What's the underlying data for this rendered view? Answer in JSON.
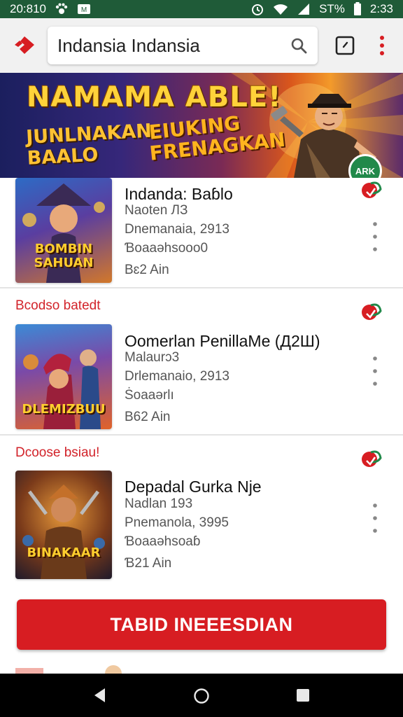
{
  "status_bar": {
    "time_left": "20:810",
    "battery_text": "ST%",
    "time_right": "2:33"
  },
  "toolbar": {
    "search_text": "Indansia  Indansia"
  },
  "banner": {
    "headline": "NAMAMA ABLE!",
    "left_logo": "JUNLNAKAN BAALO",
    "right_logo": "EIUKING FRENAGKAN",
    "badge": "ARK"
  },
  "games": [
    {
      "section_label": "",
      "title": "Indanda: Baɓlo",
      "line1": "Naoten ЛЗ",
      "line2": "Dnemanaia, 2913",
      "line3": "Ɓoaaəhsooo0",
      "line4": "Bɛ2 Ain",
      "thumb_caption": "BOMBIN SAHUAN"
    },
    {
      "section_label": "Bcodso batedt",
      "title": "Oomerlan PenillaMe (Д2Ш)",
      "line1": "Malaurɔ3",
      "line2": "Drlemanaio, 2913",
      "line3": "Ṡoaaərlı",
      "line4": "B62 Ain",
      "thumb_caption": "DLEMIZBUU"
    },
    {
      "section_label": "Dcoose bsiau!",
      "title": "Depadal Gurka Nje",
      "line1": "Nadlan 193",
      "line2": "Pnemanola, 3995",
      "line3": "Ɓoaaəhsoaɓ",
      "line4": "Ɓ21 Ain",
      "thumb_caption": "BINAKAAR"
    }
  ],
  "cta": {
    "label": "TABID INEEESDIAN"
  },
  "colors": {
    "status_bar": "#1f5b38",
    "accent": "#d71d22",
    "toolbar": "#f1f1f1"
  }
}
